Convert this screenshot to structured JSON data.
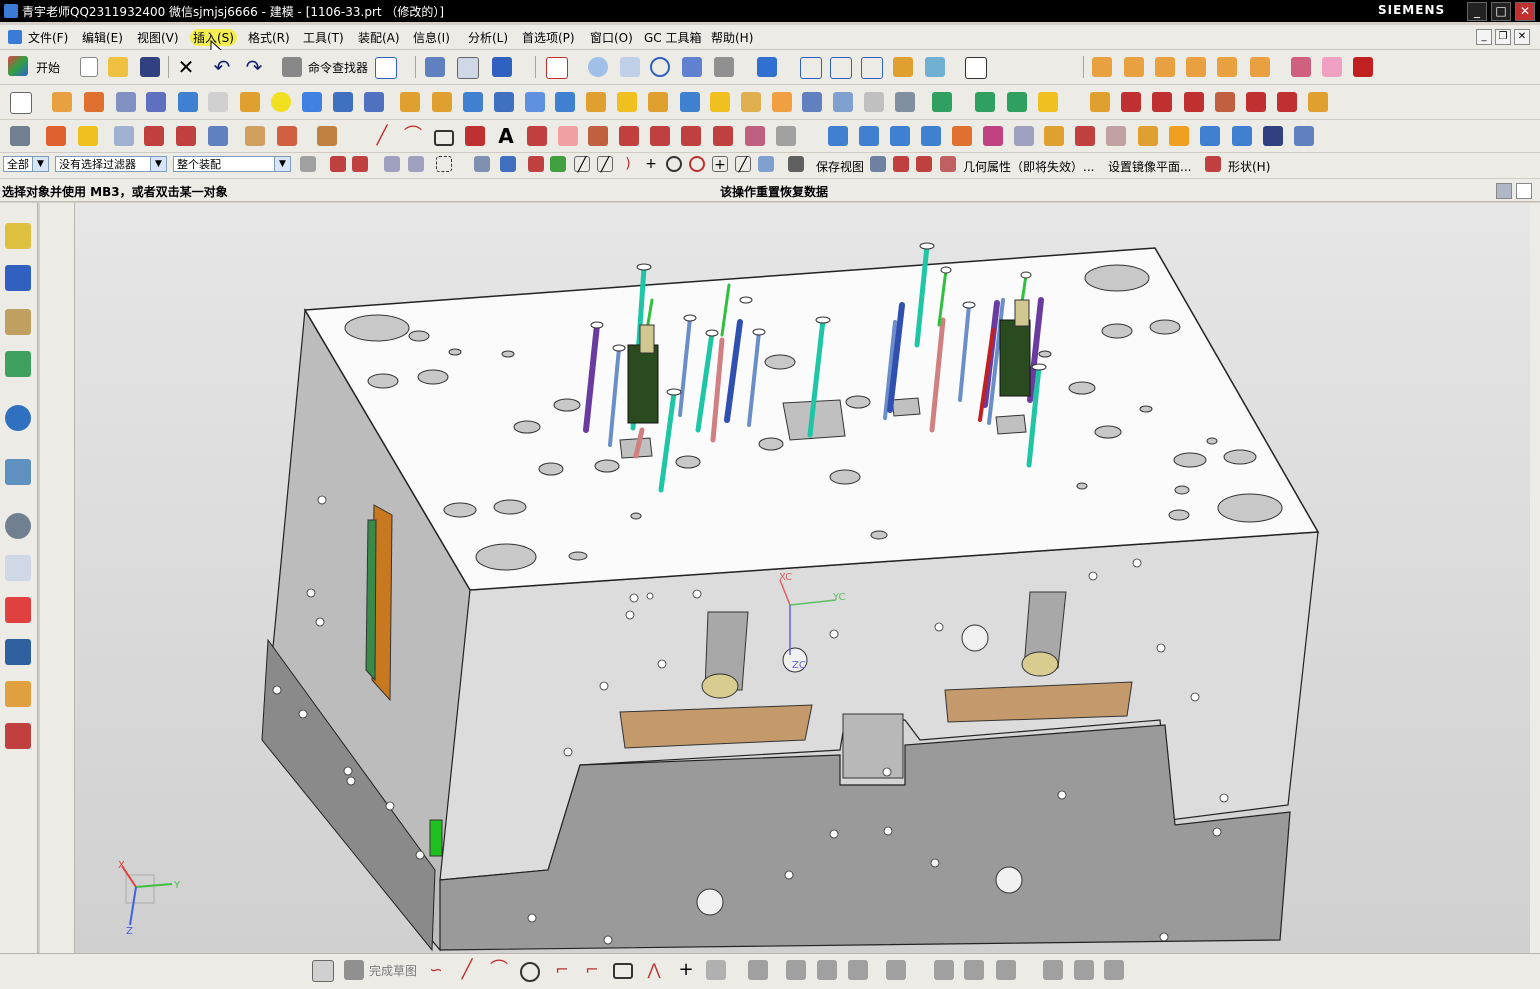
{
  "window": {
    "title": "青宇老师QQ2311932400 微信sjmjsj6666 - 建模 - [1106-33.prt （修改的）]",
    "brand": "SIEMENS",
    "minimize_label": "_",
    "maximize_label": "□",
    "close_label": "✕"
  },
  "menu": {
    "items": [
      "文件(F)",
      "编辑(E)",
      "视图(V)",
      "插入(S)",
      "格式(R)",
      "工具(T)",
      "装配(A)",
      "信息(I)",
      "分析(L)",
      "首选项(P)",
      "窗口(O)",
      "GC 工具箱",
      "帮助(H)"
    ],
    "active_index": 3
  },
  "toolbar_standard": {
    "start_label": "开始",
    "command_finder_label": "命令查找器"
  },
  "selection_bar": {
    "type_filter": "全部",
    "filter": "没有选择过滤器",
    "scope": "整个装配",
    "save_view_label": "保存视图",
    "geometry_props_label": "几何属性（即将失效）...",
    "mirror_plane_label": "设置镜像平面...",
    "shape_label": "形状(H)"
  },
  "cue_line": {
    "prompt": "选择对象并使用 MB3，或者双击某一对象",
    "status": "该操作重置恢复数据"
  },
  "sketch_bar": {
    "finish_sketch_label": "完成草图"
  },
  "viewport": {
    "wcs_labels": [
      "XC",
      "YC",
      "ZC"
    ],
    "triad_labels": [
      "X",
      "Y",
      "Z"
    ]
  },
  "colors": {
    "titlebar": "#000000",
    "toolbar": "#ecebe6",
    "menu_highlight": "#f3ee52",
    "background_top": "#e6e6e6",
    "background_bottom": "#d0d0d0",
    "plate_top": "#ffffff",
    "plate_side": "#e0e0e0",
    "plate_lower": "#a0a0a0",
    "pin_cyan": "#1fc6a6",
    "pin_blue": "#6a8ec8",
    "pin_purple": "#6a3ca0",
    "slide_copper": "#c49a6c"
  }
}
